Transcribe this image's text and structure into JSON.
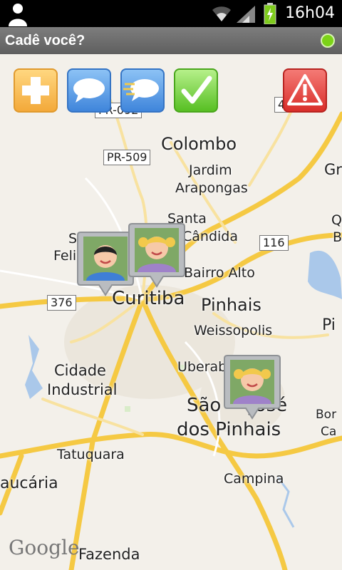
{
  "status_bar": {
    "time": "16h04",
    "icons": [
      "person-icon",
      "wifi-icon",
      "signal-icon",
      "battery-charging-icon"
    ]
  },
  "app": {
    "title": "Cadê você?",
    "status_dot_color": "#7cd317"
  },
  "toolbar": {
    "buttons": [
      {
        "name": "add-button",
        "icon": "plus-icon",
        "color": "#f7b347"
      },
      {
        "name": "message-button",
        "icon": "speech-bubble-icon",
        "color": "#4f96e6"
      },
      {
        "name": "fast-message-button",
        "icon": "fast-speech-bubble-icon",
        "color": "#4f96e6"
      },
      {
        "name": "check-button",
        "icon": "checkmark-icon",
        "color": "#6ccf2e"
      },
      {
        "name": "alert-button",
        "icon": "warning-icon",
        "color": "#e53a36"
      }
    ]
  },
  "map": {
    "labels": {
      "colombo": "Colombo",
      "jardim": "Jardim",
      "arapongas": "Arapongas",
      "santa": "Santa",
      "candida": "Cândida",
      "s": "S",
      "feli": "Feli",
      "bairro_alto": "Bairro Alto",
      "curitiba": "Curitiba",
      "pinhais": "Pinhais",
      "weissopolis": "Weissopolis",
      "uberab": "Uberab",
      "cidade": "Cidade",
      "industrial": "Industrial",
      "sao": "São",
      "jose": "José",
      "dos_pinhais": "dos Pinhais",
      "tatuquara": "Tatuquara",
      "campina": "Campina",
      "aucaria": "aucária",
      "fazenda": "Fazenda",
      "gr": "Gr",
      "q": "Q",
      "b": "B",
      "pi": "Pi",
      "bor": "Bor",
      "ca": "Ca"
    },
    "route_shields": {
      "pr092": "PR-092",
      "pr509": "PR-509",
      "r476": "476",
      "r116": "116",
      "r376": "376"
    },
    "markers": [
      {
        "name": "marker-boy",
        "avatar": "boy-avatar-icon"
      },
      {
        "name": "marker-girl-1",
        "avatar": "girl-avatar-icon"
      },
      {
        "name": "marker-girl-2",
        "avatar": "girl-avatar-icon"
      }
    ],
    "attribution": "Google"
  }
}
